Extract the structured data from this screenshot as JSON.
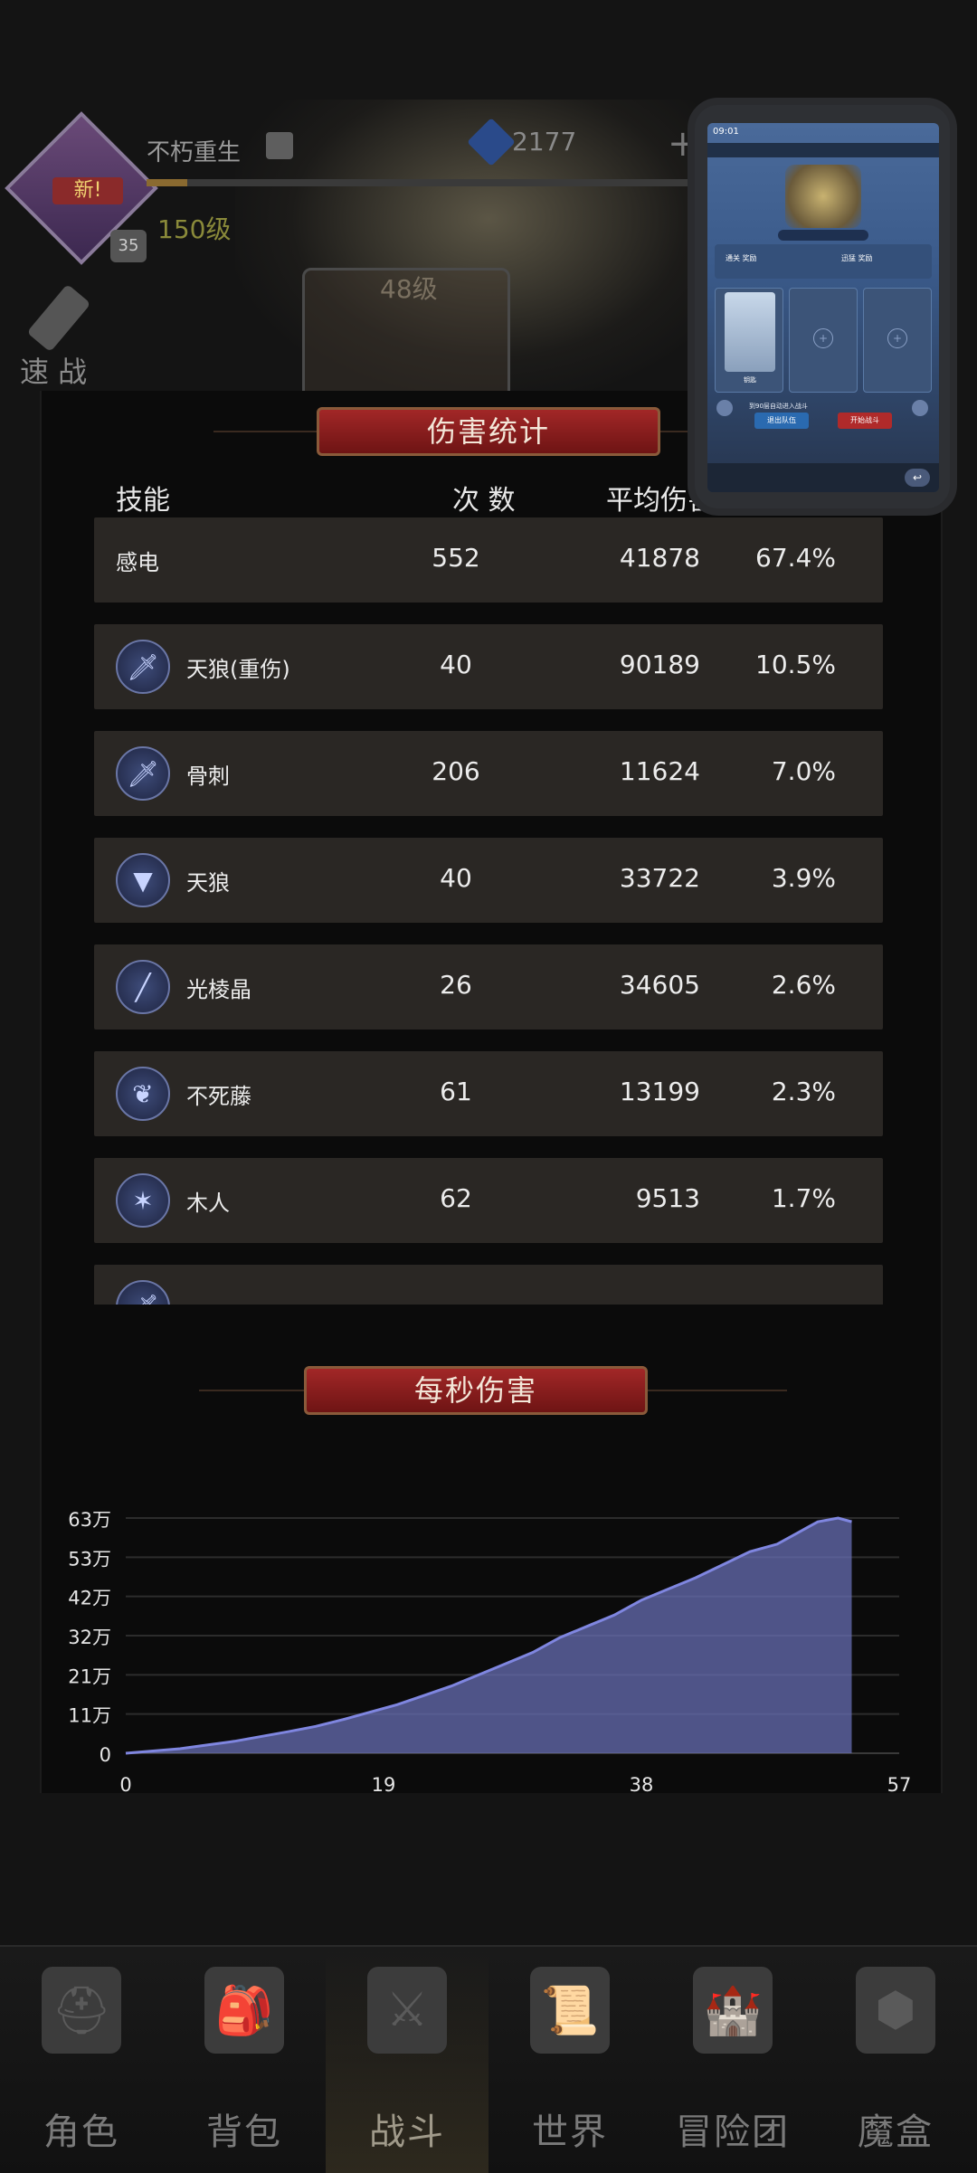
{
  "player": {
    "name": "不朽重生",
    "new_badge": "新!",
    "level_chip": "35",
    "level": "150级",
    "gems": "2177",
    "quick_battle": "速 战",
    "stage": "48级"
  },
  "stats": {
    "title": "伤害统计",
    "headers": {
      "skill": "技能",
      "count": "次 数",
      "avg": "平均伤害"
    },
    "rows": [
      {
        "name": "感电",
        "count": "552",
        "avg": "41878",
        "pct": "67.4%",
        "icon": ""
      },
      {
        "name": "天狼(重伤)",
        "count": "40",
        "avg": "90189",
        "pct": "10.5%",
        "icon": "sword-icon"
      },
      {
        "name": "骨刺",
        "count": "206",
        "avg": "11624",
        "pct": "7.0%",
        "icon": "sword-icon"
      },
      {
        "name": "天狼",
        "count": "40",
        "avg": "33722",
        "pct": "3.9%",
        "icon": "fang-icon"
      },
      {
        "name": "光棱晶",
        "count": "26",
        "avg": "34605",
        "pct": "2.6%",
        "icon": "beam-icon"
      },
      {
        "name": "不死藤",
        "count": "61",
        "avg": "13199",
        "pct": "2.3%",
        "icon": "vine-icon"
      },
      {
        "name": "木人",
        "count": "62",
        "avg": "9513",
        "pct": "1.7%",
        "icon": "slash-icon"
      },
      {
        "name": "",
        "count": "",
        "avg": "",
        "pct": "",
        "icon": "sword-icon"
      }
    ]
  },
  "dps": {
    "title": "每秒伤害"
  },
  "chart_data": {
    "type": "area",
    "title": "每秒伤害",
    "xlabel": "",
    "ylabel": "",
    "x_ticks": [
      "0",
      "19",
      "38",
      "57"
    ],
    "y_ticks": [
      "0",
      "11万",
      "21万",
      "32万",
      "42万",
      "53万",
      "63万"
    ],
    "xlim": [
      0,
      57
    ],
    "ylim": [
      0,
      630000
    ],
    "grid": true,
    "series_color": "#6a70b8",
    "x": [
      0,
      2,
      4,
      6,
      8,
      10,
      12,
      14,
      16,
      18,
      20,
      22,
      24,
      26,
      28,
      30,
      32,
      34,
      36,
      38,
      40,
      42,
      44,
      46,
      48,
      49.5,
      51,
      52.5,
      53.5
    ],
    "values": [
      0,
      6000,
      12000,
      22000,
      32000,
      45000,
      58000,
      72000,
      90000,
      110000,
      130000,
      155000,
      180000,
      210000,
      240000,
      270000,
      310000,
      340000,
      370000,
      410000,
      440000,
      470000,
      505000,
      540000,
      560000,
      590000,
      620000,
      630000,
      620000
    ]
  },
  "nav": {
    "items": [
      {
        "label": "角色",
        "icon": "helmet-icon",
        "glyph": "⛑"
      },
      {
        "label": "背包",
        "icon": "backpack-icon",
        "glyph": "🎒"
      },
      {
        "label": "战斗",
        "icon": "shield-sword-icon",
        "glyph": "⚔"
      },
      {
        "label": "世界",
        "icon": "map-scroll-icon",
        "glyph": "📜"
      },
      {
        "label": "冒险团",
        "icon": "castle-icon",
        "glyph": "🏰"
      },
      {
        "label": "魔盒",
        "icon": "magic-cube-icon",
        "glyph": "⬢"
      }
    ],
    "active": 2
  },
  "preview": {
    "time": "09:01",
    "reward_left": "通关\n奖励",
    "reward_right": "迅猛\n奖励",
    "auto_text": "到90层自动进入战斗",
    "quit": "退出队伍",
    "start": "开始战斗",
    "char_name": "钥匙"
  },
  "colors": {
    "banner": "#a22727",
    "row_bg": "#2a2724",
    "area_fill": "#6a70b8"
  }
}
